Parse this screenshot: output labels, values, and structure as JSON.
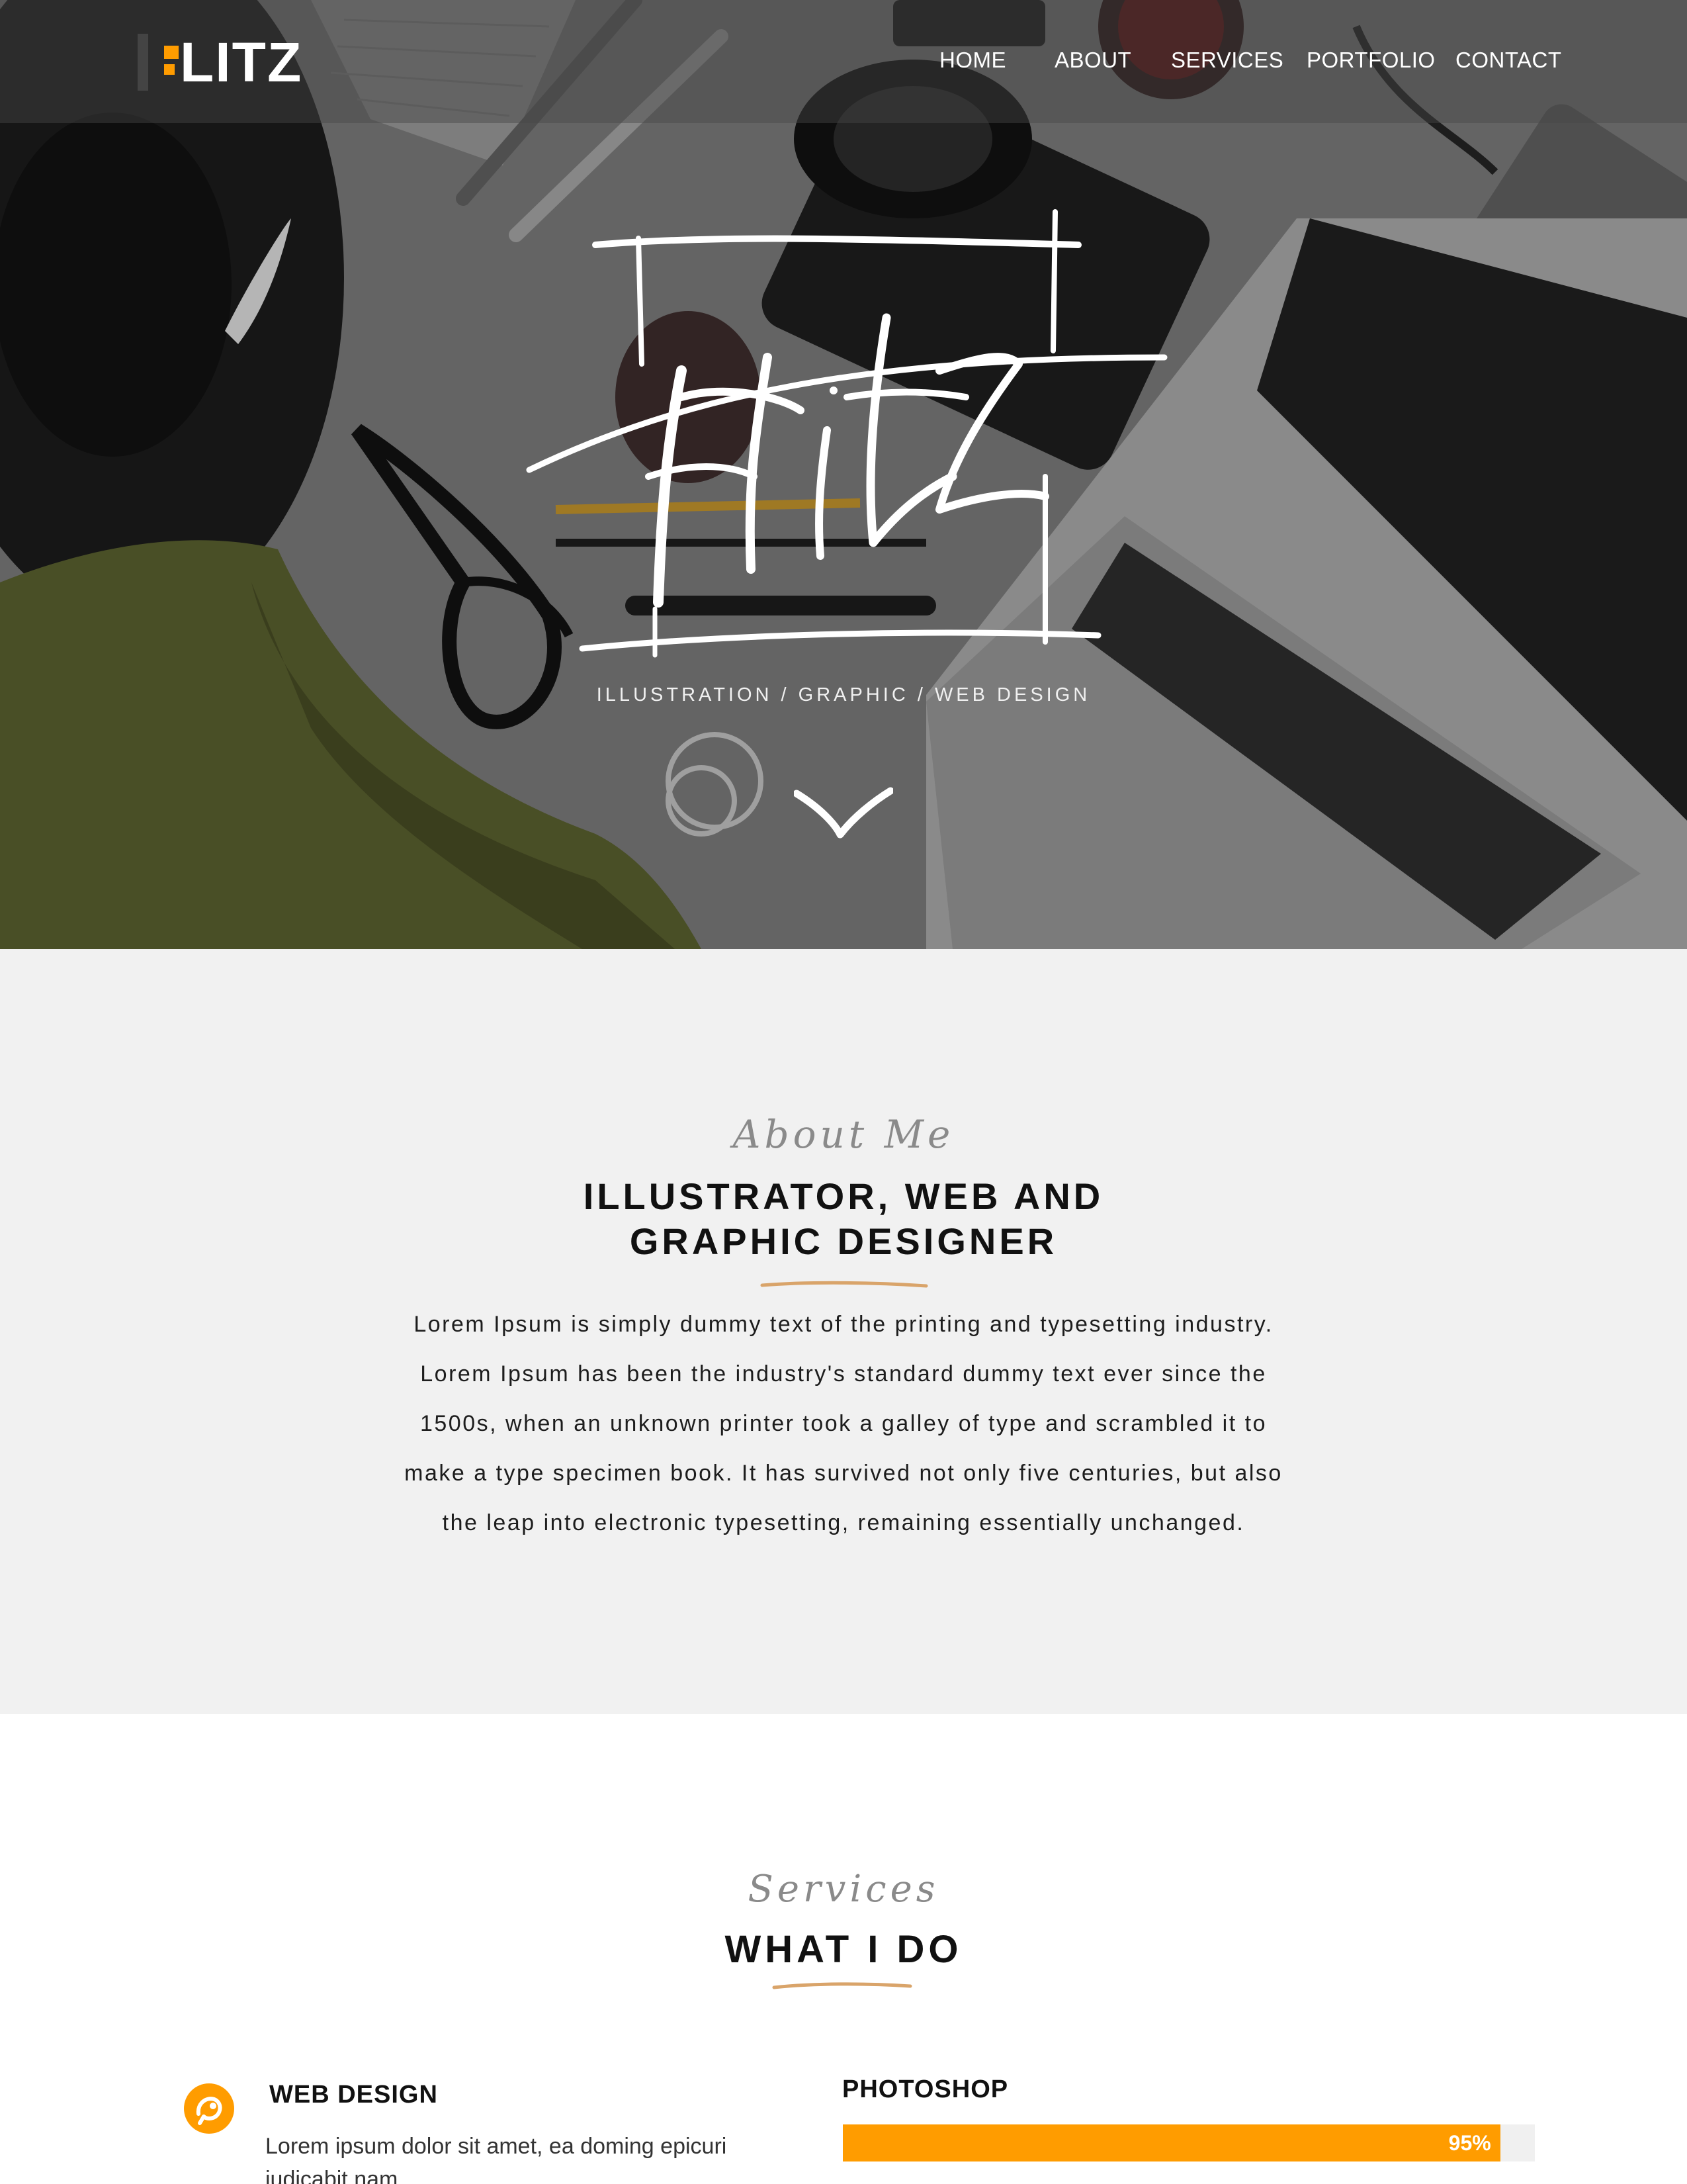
{
  "brand": {
    "logo_text": "LITZ",
    "accent_color": "#ff9c00"
  },
  "nav": {
    "items": [
      {
        "label": "HOME"
      },
      {
        "label": "ABOUT"
      },
      {
        "label": "SERVICES"
      },
      {
        "label": "PORTFOLIO"
      },
      {
        "label": "CONTACT"
      }
    ]
  },
  "hero": {
    "tagline": "ILLUSTRATION / GRAPHIC / WEB DESIGN",
    "scroll_icon": "chevron-down-icon"
  },
  "about": {
    "script_label": "About Me",
    "title_line1": "ILLUSTRATOR, WEB AND",
    "title_line2": "GRAPHIC DESIGNER",
    "body": "Lorem Ipsum is simply dummy text of the printing and typesetting industry. Lorem Ipsum has been the industry's standard dummy text ever since the 1500s, when an unknown printer took a galley of type and scrambled it to make a type specimen book. It has survived not only five centuries, but also the leap into electronic typesetting, remaining essentially unchanged."
  },
  "services": {
    "script_label": "Services",
    "title": "WHAT I DO",
    "items": [
      {
        "icon": "web-design-icon",
        "title": "WEB DESIGN",
        "description": "Lorem ipsum dolor sit amet, ea doming epicuri iudicabit nam"
      }
    ],
    "skills": [
      {
        "label": "PHOTOSHOP",
        "percent_label": "95%",
        "percent": 95
      }
    ]
  }
}
